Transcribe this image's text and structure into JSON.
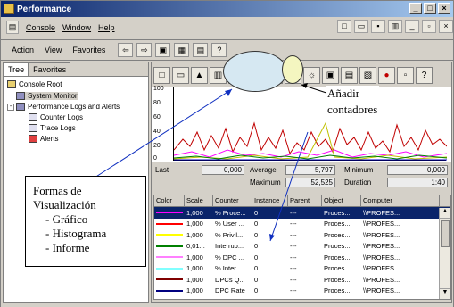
{
  "window": {
    "title": "Performance"
  },
  "menu": {
    "console": "Console",
    "window": "Window",
    "help": "Help"
  },
  "toolbar": {
    "action": "Action",
    "view": "View",
    "favorites": "Favorites"
  },
  "tree": {
    "tabs": [
      "Tree",
      "Favorites"
    ],
    "nodes": [
      "Console Root",
      "System Monitor",
      "Performance Logs and Alerts",
      "Counter Logs",
      "Trace Logs",
      "Alerts"
    ]
  },
  "graph": {
    "y_ticks": [
      "100",
      "80",
      "60",
      "40",
      "20",
      "0"
    ]
  },
  "stats": {
    "last_label": "Last",
    "last_value": "0,000",
    "average_label": "Average",
    "average_value": "5,797",
    "minimum_label": "Minimum",
    "minimum_value": "0,000",
    "maximum_label": "Maximum",
    "maximum_value": "52,525",
    "duration_label": "Duration",
    "duration_value": "1:40"
  },
  "table": {
    "headers": [
      "Color",
      "Scale",
      "Counter",
      "Instance",
      "Parent",
      "Object",
      "Computer"
    ],
    "rows": [
      {
        "color": "#ff00ff",
        "scale": "1,000",
        "counter": "% Proce...",
        "instance": "0",
        "parent": "---",
        "object": "Proces...",
        "computer": "\\\\PROFES..."
      },
      {
        "color": "#ff0000",
        "scale": "1,000",
        "counter": "% User ...",
        "instance": "0",
        "parent": "---",
        "object": "Proces...",
        "computer": "\\\\PROFES..."
      },
      {
        "color": "#ffff00",
        "scale": "1,000",
        "counter": "% Privil...",
        "instance": "0",
        "parent": "---",
        "object": "Proces...",
        "computer": "\\\\PROFES..."
      },
      {
        "color": "#008000",
        "scale": "0,01...",
        "counter": "Interrup...",
        "instance": "0",
        "parent": "---",
        "object": "Proces...",
        "computer": "\\\\PROFES..."
      },
      {
        "color": "#ff80ff",
        "scale": "1,000",
        "counter": "% DPC ...",
        "instance": "0",
        "parent": "---",
        "object": "Proces...",
        "computer": "\\\\PROFES..."
      },
      {
        "color": "#80ffff",
        "scale": "1,000",
        "counter": "% Inter...",
        "instance": "0",
        "parent": "---",
        "object": "Proces...",
        "computer": "\\\\PROFES..."
      },
      {
        "color": "#800000",
        "scale": "1,000",
        "counter": "DPCs Q...",
        "instance": "0",
        "parent": "---",
        "object": "Proces...",
        "computer": "\\\\PROFES..."
      },
      {
        "color": "#000080",
        "scale": "1,000",
        "counter": "DPC Rate",
        "instance": "0",
        "parent": "---",
        "object": "Proces...",
        "computer": "\\\\PROFES..."
      }
    ]
  },
  "annotations": {
    "add_counters": [
      "Añadir",
      "contadores"
    ],
    "views_title": [
      "Formas de",
      "Visualización"
    ],
    "views_items": [
      "- Gráfico",
      "- Histograma",
      "- Informe"
    ]
  }
}
